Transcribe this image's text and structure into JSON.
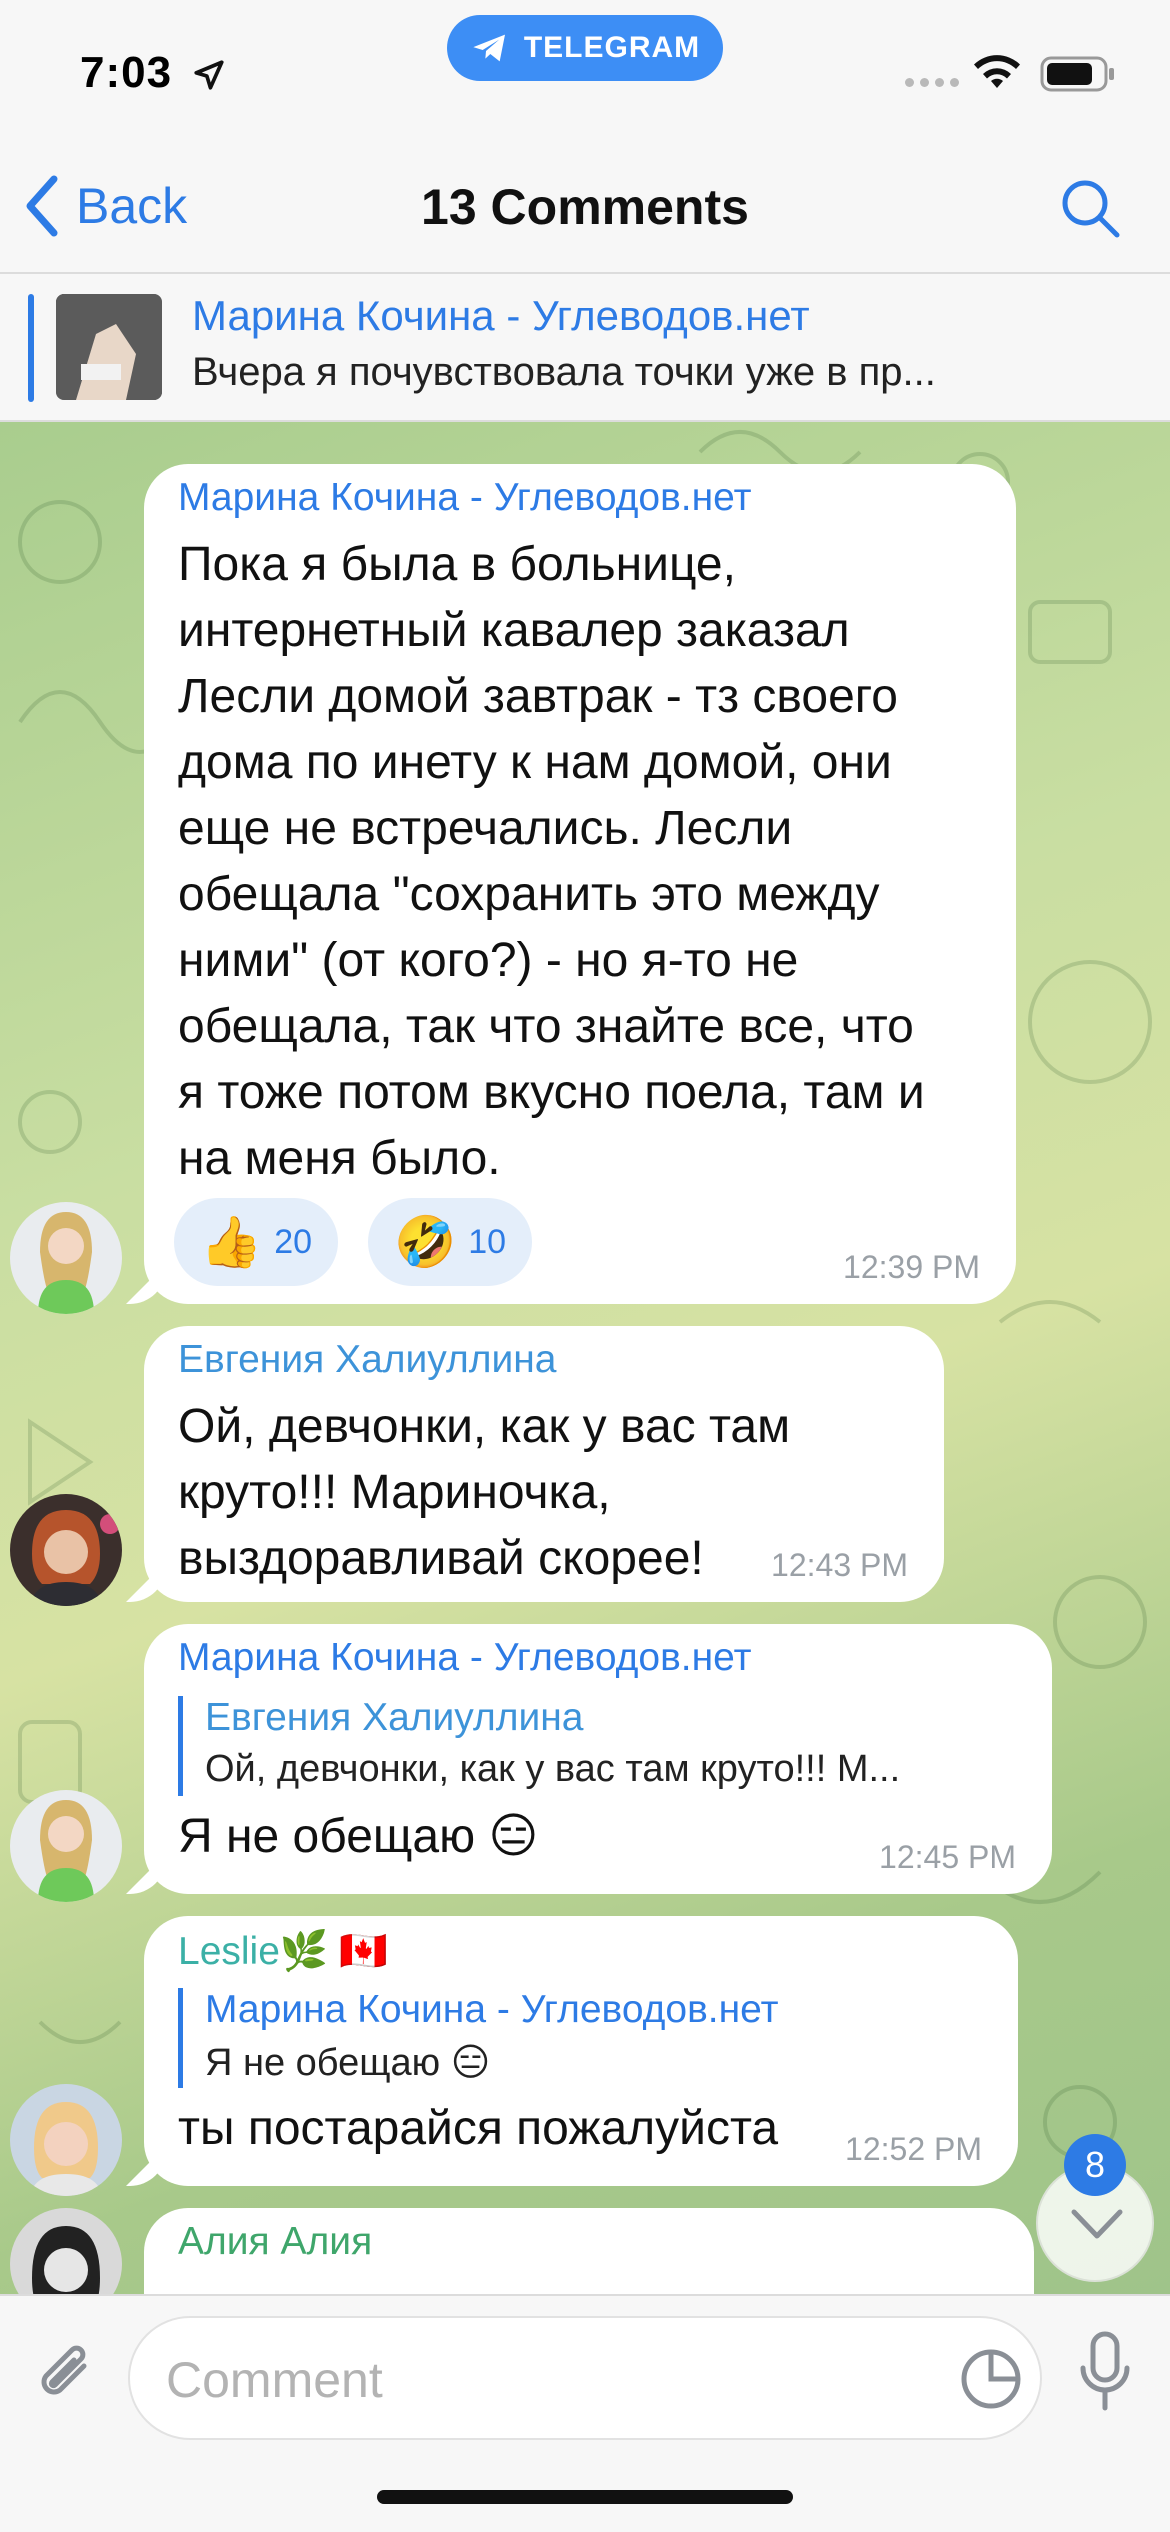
{
  "status_bar": {
    "time": "7:03",
    "app_pill": "TELEGRAM"
  },
  "nav": {
    "back_label": "Back",
    "title": "13 Comments"
  },
  "pinned": {
    "title": "Марина Кочина - Углеводов.нет",
    "text": "Вчера я почувствовала точки уже в пр..."
  },
  "messages": [
    {
      "author": "Марина Кочина - Углеводов.нет",
      "author_color": "#2d7be5",
      "lines": [
        "Пока я была в больнице,",
        "интернетный кавалер заказал",
        "Лесли домой завтрак - тз своего",
        "дома по инету к нам домой, они",
        "еще не встречались. Лесли",
        "обещала \"сохранить это между",
        "ними\" (от кого?) - но я-то не",
        "обещала, так что знайте все, что",
        "я тоже потом вкусно поела, там и",
        "на меня было."
      ],
      "reactions": [
        {
          "emoji": "👍",
          "count": "20"
        },
        {
          "emoji": "🤣",
          "count": "10"
        }
      ],
      "time": "12:39 PM"
    },
    {
      "author": "Евгения Халиуллина",
      "author_color": "#3d93d9",
      "lines": [
        "Ой, девчонки, как у вас там",
        "круто!!! Мариночка,",
        "выздоравливай скорее!"
      ],
      "time": "12:43 PM"
    },
    {
      "author": "Марина Кочина - Углеводов.нет",
      "author_color": "#2d7be5",
      "reply": {
        "name": "Евгения Халиуллина",
        "text": "Ой, девчонки, как у вас там круто!!! М..."
      },
      "text": "Я не обещаю 😑",
      "time": "12:45 PM"
    },
    {
      "author": "Leslie🌿 🇨🇦",
      "author_color": "#3bb0a6",
      "reply": {
        "name": "Марина Кочина - Углеводов.нет",
        "text": "Я не обещаю 😑"
      },
      "text": "ты постарайся пожалуйста",
      "time": "12:52 PM"
    },
    {
      "author": "Алия Алия",
      "author_color": "#3fa66b"
    }
  ],
  "scroll_badge": "8",
  "composer": {
    "placeholder": "Comment"
  },
  "colors": {
    "accent": "#2d7be5",
    "pill": "#3d8ef5"
  },
  "icons": [
    "location-arrow-icon",
    "telegram-plane-icon",
    "wifi-icon",
    "battery-icon",
    "back-chevron-icon",
    "search-icon",
    "chevron-down-icon",
    "paperclip-icon",
    "sticker-icon",
    "microphone-icon"
  ]
}
